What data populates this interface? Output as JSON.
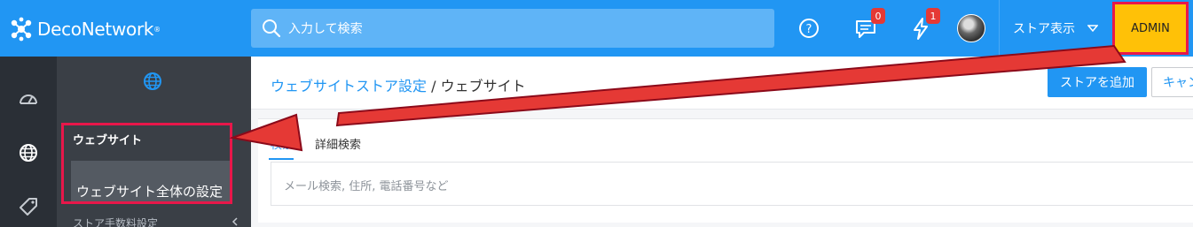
{
  "brand": {
    "name": "DecoNetwork",
    "reg": "®"
  },
  "search": {
    "placeholder": "入力して検索"
  },
  "topbar": {
    "help_icon": "question-circle-icon",
    "messages": {
      "icon": "chat-icon",
      "count": "0"
    },
    "alerts": {
      "icon": "lightning-icon",
      "count": "1"
    },
    "store_view_label": "ストア表示",
    "admin_label": "ADMIN"
  },
  "rail": {
    "items": [
      "dashboard-icon",
      "globe-icon",
      "tag-icon"
    ]
  },
  "subnav": {
    "section_title": "ウェブサイト",
    "active_item": "ウェブサイト全体の設定",
    "next_item": "ストア手数料設定"
  },
  "breadcrumb": {
    "parent": "ウェブサイトストア設定",
    "separator": "/",
    "current": "ウェブサイト"
  },
  "actions": {
    "add_store": "ストアを追加",
    "cancel": "キャンセル"
  },
  "tabs": [
    {
      "label": "検索"
    },
    {
      "label": "詳細検索"
    }
  ],
  "search_field": {
    "placeholder": "メール検索, 住所, 電話番号など"
  },
  "colors": {
    "primary": "#2196f3",
    "admin": "#ffc107",
    "highlight": "#e8174a",
    "sidebar": "#2a2f36"
  }
}
